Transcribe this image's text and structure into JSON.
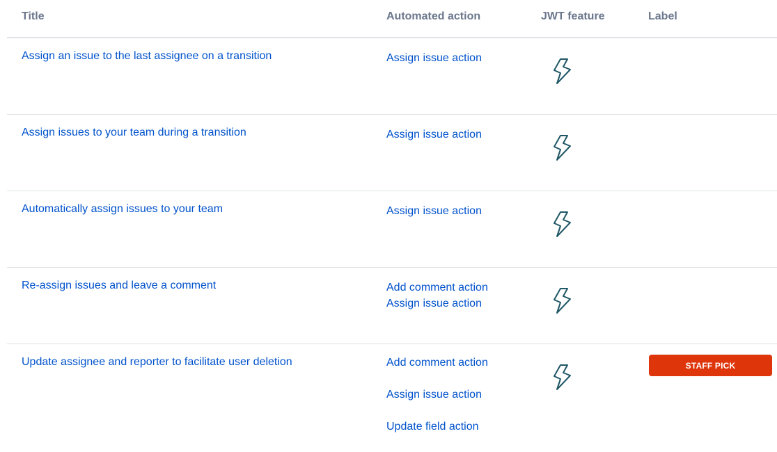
{
  "headers": {
    "title": "Title",
    "action": "Automated action",
    "jwt": "JWT feature",
    "label": "Label"
  },
  "rows": [
    {
      "title": "Assign an issue to the last assignee on a transition",
      "actions": [
        "Assign issue action"
      ],
      "jwt_icon": "lightning-bolt-icon"
    },
    {
      "title": "Assign issues to your team during a transition",
      "actions": [
        "Assign issue action"
      ],
      "jwt_icon": "lightning-bolt-icon"
    },
    {
      "title": "Automatically assign issues to your team",
      "actions": [
        "Assign issue action"
      ],
      "jwt_icon": "lightning-bolt-icon"
    },
    {
      "title": "Re-assign issues and leave a comment",
      "actions": [
        "Add comment action",
        "Assign issue action"
      ],
      "jwt_icon": "lightning-bolt-icon"
    },
    {
      "title": "Update assignee and reporter to facilitate user deletion",
      "actions": [
        "Add comment action",
        "Assign issue action",
        "Update field action"
      ],
      "jwt_icon": "lightning-bolt-icon",
      "label": "STAFF PICK"
    }
  ],
  "colors": {
    "link": "#0052cc",
    "header_text": "#6b778c",
    "divider": "#dfe1e6",
    "icon_stroke": "#1f5666",
    "badge_bg": "#de350b",
    "badge_text": "#ffffff"
  }
}
